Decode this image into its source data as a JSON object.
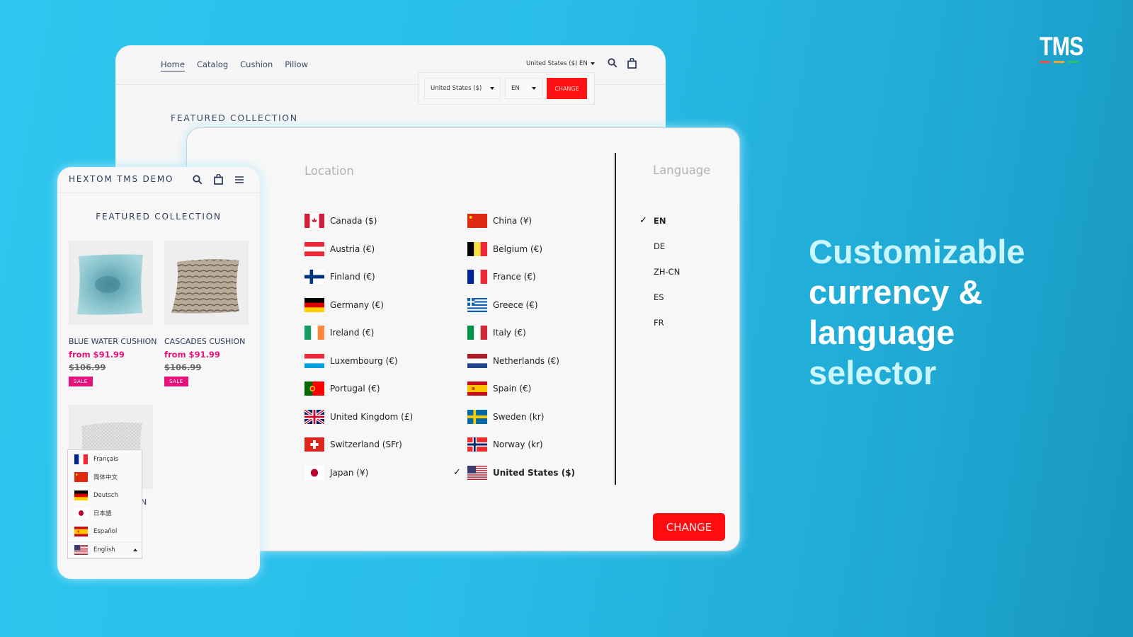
{
  "brand": {
    "logo_text": "TMS",
    "logo_bar_colors": [
      "#f04e3e",
      "#f5a623",
      "#27c46b"
    ]
  },
  "headline": {
    "lines": [
      {
        "text": "Customizable",
        "color": "#c9f6ff"
      },
      {
        "text": "currency &",
        "color": "#ffffff"
      },
      {
        "text": "language",
        "color": "#ffffff"
      },
      {
        "text": "selector",
        "color": "#c9f6ff"
      }
    ]
  },
  "desktop": {
    "nav": [
      {
        "label": "Home",
        "active": true
      },
      {
        "label": "Catalog",
        "active": false
      },
      {
        "label": "Cushion",
        "active": false
      },
      {
        "label": "Pillow",
        "active": false
      }
    ],
    "selector_label": "United States ($) EN",
    "popover": {
      "country_value": "United States ($)",
      "language_value": "EN",
      "change_label": "CHANGE"
    },
    "featured_title": "FEATURED COLLECTION"
  },
  "modal": {
    "location_title": "Location",
    "language_title": "Language",
    "countries": [
      {
        "label": "Canada ($)",
        "flag": "ca"
      },
      {
        "label": "China (¥)",
        "flag": "cn"
      },
      {
        "label": "Austria (€)",
        "flag": "at"
      },
      {
        "label": "Belgium (€)",
        "flag": "be"
      },
      {
        "label": "Finland (€)",
        "flag": "fi"
      },
      {
        "label": "France (€)",
        "flag": "fr"
      },
      {
        "label": "Germany (€)",
        "flag": "de"
      },
      {
        "label": "Greece (€)",
        "flag": "gr"
      },
      {
        "label": "Ireland (€)",
        "flag": "ie"
      },
      {
        "label": "Italy (€)",
        "flag": "it"
      },
      {
        "label": "Luxembourg (€)",
        "flag": "lu"
      },
      {
        "label": "Netherlands (€)",
        "flag": "nl"
      },
      {
        "label": "Portugal (€)",
        "flag": "pt"
      },
      {
        "label": "Spain (€)",
        "flag": "es"
      },
      {
        "label": "United Kingdom (£)",
        "flag": "gb"
      },
      {
        "label": "Sweden (kr)",
        "flag": "se"
      },
      {
        "label": "Switzerland (SFr)",
        "flag": "ch"
      },
      {
        "label": "Norway (kr)",
        "flag": "no"
      },
      {
        "label": "Japan (¥)",
        "flag": "jp"
      },
      {
        "label": "United States ($)",
        "flag": "us",
        "selected": true
      }
    ],
    "languages": [
      {
        "label": "EN",
        "selected": true
      },
      {
        "label": "DE"
      },
      {
        "label": "ZH-CN"
      },
      {
        "label": "ES"
      },
      {
        "label": "FR"
      }
    ],
    "check_mark": "✓",
    "change_label": "CHANGE"
  },
  "mobile": {
    "brand": "HEXTOM TMS DEMO",
    "featured_title": "FEATURED COLLECTION",
    "products": [
      {
        "name": "BLUE WATER CUSHION",
        "price": "from $91.99",
        "original_price": "$106.99",
        "badge": "SALE",
        "image": "blue-watercolor-cushion"
      },
      {
        "name": "CASCADES CUSHION",
        "price": "from $91.99",
        "original_price": "$106.99",
        "badge": "SALE",
        "image": "leaf-pattern-cushion"
      },
      {
        "name": "N",
        "image": "white-textured-cushion"
      }
    ],
    "language_dropdown": {
      "options": [
        {
          "label": "Français",
          "flag": "fr"
        },
        {
          "label": "简体中文",
          "flag": "cn"
        },
        {
          "label": "Deutsch",
          "flag": "de"
        },
        {
          "label": "日本語",
          "flag": "jp"
        },
        {
          "label": "Español",
          "flag": "es"
        }
      ],
      "current": {
        "label": "English",
        "flag": "us"
      }
    }
  },
  "colors": {
    "accent_red": "#ff0c10",
    "sale_pink": "#e6127b",
    "nav_text": "#3a4766"
  }
}
